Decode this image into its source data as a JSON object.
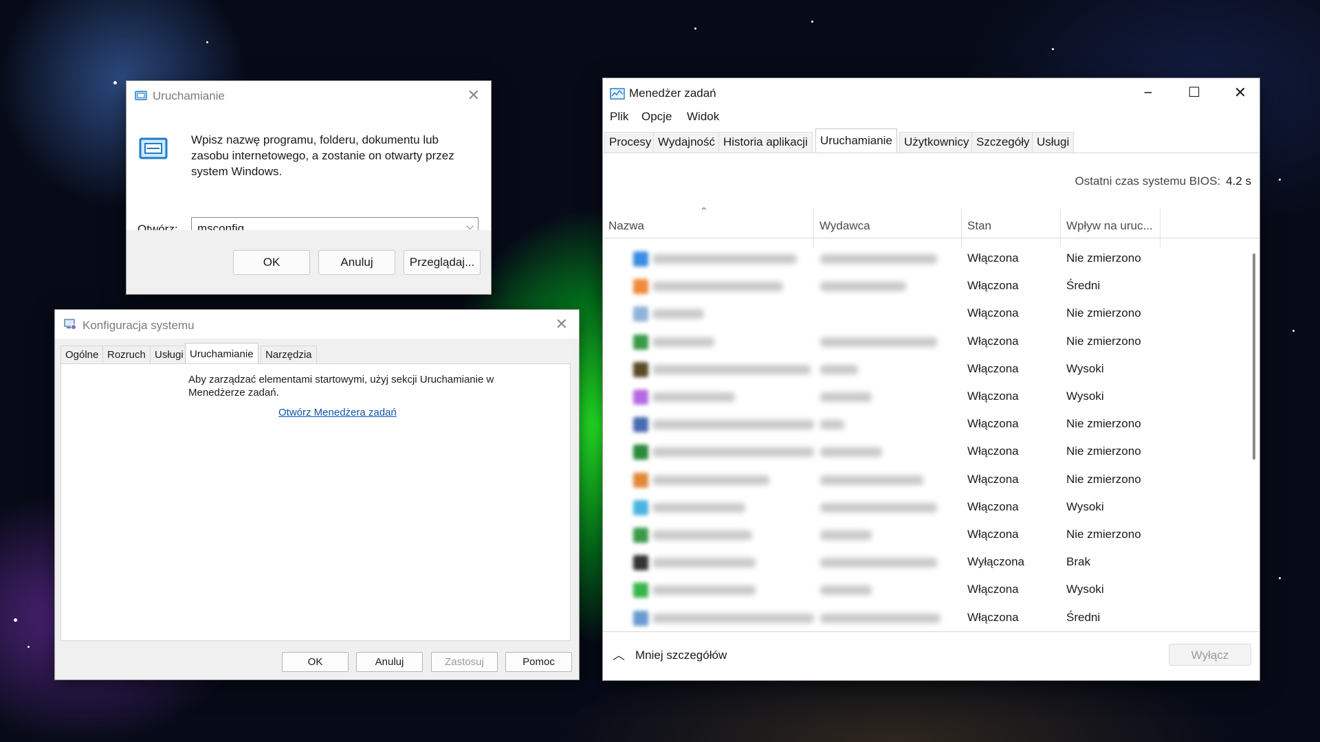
{
  "run_dialog": {
    "title": "Uruchamianie",
    "description": "Wpisz nazwę programu, folderu, dokumentu lub zasobu internetowego, a zostanie on otwarty przez system Windows.",
    "open_label": "Otwórz:",
    "input_value": "msconfig",
    "ok": "OK",
    "cancel": "Anuluj",
    "browse": "Przeglądaj..."
  },
  "msconfig": {
    "title": "Konfiguracja systemu",
    "tabs": [
      "Ogólne",
      "Rozruch",
      "Usługi",
      "Uruchamianie",
      "Narzędzia"
    ],
    "active_tab": "Uruchamianie",
    "message": "Aby zarządzać elementami startowymi, użyj sekcji Uruchamianie w Menedżerze zadań.",
    "link": "Otwórz Menedżera zadań",
    "buttons": {
      "ok": "OK",
      "cancel": "Anuluj",
      "apply": "Zastosuj",
      "help": "Pomoc"
    }
  },
  "task_manager": {
    "title": "Menedżer zadań",
    "menu": [
      "Plik",
      "Opcje",
      "Widok"
    ],
    "tabs": [
      "Procesy",
      "Wydajność",
      "Historia aplikacji",
      "Uruchamianie",
      "Użytkownicy",
      "Szczegóły",
      "Usługi"
    ],
    "active_tab": "Uruchamianie",
    "bios_label": "Ostatni czas systemu BIOS:",
    "bios_value": "4.2 s",
    "columns": [
      "Nazwa",
      "Wydawca",
      "Stan",
      "Wpływ na uruc..."
    ],
    "rows": [
      {
        "state": "Włączona",
        "impact": "Nie zmierzono",
        "icon_color": "#3a8de0"
      },
      {
        "state": "Włączona",
        "impact": "Średni",
        "icon_color": "#f08a3a"
      },
      {
        "state": "Włączona",
        "impact": "Nie zmierzono",
        "icon_color": "#8fb4d8"
      },
      {
        "state": "Włączona",
        "impact": "Nie zmierzono",
        "icon_color": "#3a9a4a"
      },
      {
        "state": "Włączona",
        "impact": "Wysoki",
        "icon_color": "#5a4a2a"
      },
      {
        "state": "Włączona",
        "impact": "Wysoki",
        "icon_color": "#b46ae0"
      },
      {
        "state": "Włączona",
        "impact": "Nie zmierzono",
        "icon_color": "#4a6ab0"
      },
      {
        "state": "Włączona",
        "impact": "Nie zmierzono",
        "icon_color": "#2a8a3a"
      },
      {
        "state": "Włączona",
        "impact": "Nie zmierzono",
        "icon_color": "#e08a3a"
      },
      {
        "state": "Włączona",
        "impact": "Wysoki",
        "icon_color": "#4ab4e0"
      },
      {
        "state": "Włączona",
        "impact": "Nie zmierzono",
        "icon_color": "#3a9a4a"
      },
      {
        "state": "Wyłączona",
        "impact": "Brak",
        "icon_color": "#333333"
      },
      {
        "state": "Włączona",
        "impact": "Wysoki",
        "icon_color": "#3ab44a"
      },
      {
        "state": "Włączona",
        "impact": "Średni",
        "icon_color": "#6a9ad0"
      }
    ],
    "fewer_details": "Mniej szczegółów",
    "disable_button": "Wyłącz"
  }
}
